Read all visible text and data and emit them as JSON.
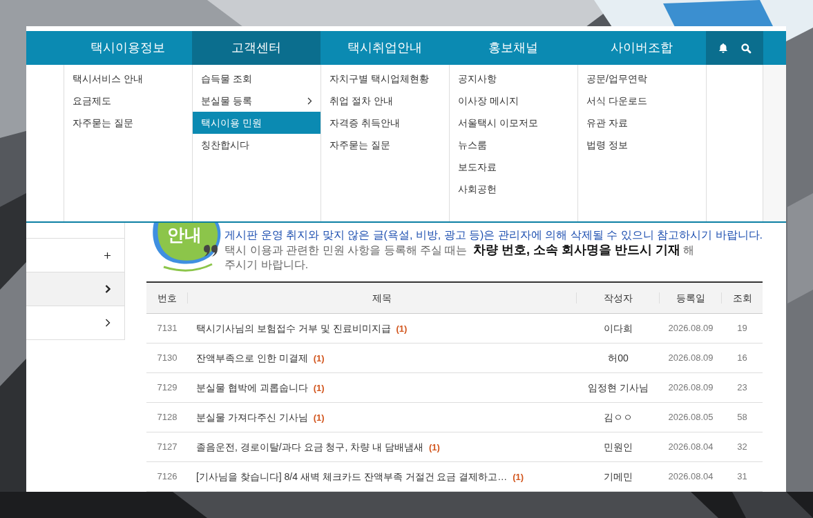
{
  "nav": {
    "items": [
      {
        "label": "택시이용정보",
        "selected": false
      },
      {
        "label": "고객센터",
        "selected": true
      },
      {
        "label": "택시취업안내",
        "selected": false
      },
      {
        "label": "홍보채널",
        "selected": false
      },
      {
        "label": "사이버조합",
        "selected": false
      }
    ]
  },
  "menu_columns": [
    {
      "items": [
        {
          "label": "택시서비스 안내",
          "selected": false,
          "has_submenu": false
        },
        {
          "label": "요금제도",
          "selected": false,
          "has_submenu": false
        },
        {
          "label": "자주묻는 질문",
          "selected": false,
          "has_submenu": false
        }
      ]
    },
    {
      "items": [
        {
          "label": "습득물 조회",
          "selected": false,
          "has_submenu": false
        },
        {
          "label": "분실물 등록",
          "selected": false,
          "has_submenu": true
        },
        {
          "label": "택시이용 민원",
          "selected": true,
          "has_submenu": false
        },
        {
          "label": "칭찬합시다",
          "selected": false,
          "has_submenu": false
        }
      ]
    },
    {
      "items": [
        {
          "label": "자치구별 택시업체현황",
          "selected": false,
          "has_submenu": false
        },
        {
          "label": "취업 절차 안내",
          "selected": false,
          "has_submenu": false
        },
        {
          "label": "자격증 취득안내",
          "selected": false,
          "has_submenu": false
        },
        {
          "label": "자주묻는 질문",
          "selected": false,
          "has_submenu": false
        }
      ]
    },
    {
      "items": [
        {
          "label": "공지사항",
          "selected": false,
          "has_submenu": false
        },
        {
          "label": "이사장 메시지",
          "selected": false,
          "has_submenu": false
        },
        {
          "label": "서울택시 이모저모",
          "selected": false,
          "has_submenu": false
        },
        {
          "label": "뉴스룸",
          "selected": false,
          "has_submenu": false
        },
        {
          "label": "보도자료",
          "selected": false,
          "has_submenu": false
        },
        {
          "label": "사회공헌",
          "selected": false,
          "has_submenu": false
        }
      ]
    },
    {
      "items": [
        {
          "label": "공문/업무연락",
          "selected": false,
          "has_submenu": false
        },
        {
          "label": "서식 다운로드",
          "selected": false,
          "has_submenu": false
        },
        {
          "label": "유관 자료",
          "selected": false,
          "has_submenu": false
        },
        {
          "label": "법령 정보",
          "selected": false,
          "has_submenu": false
        }
      ]
    }
  ],
  "sidebar": {
    "items": [
      {
        "kind": "plus",
        "selected": false
      },
      {
        "kind": "chevron",
        "selected": true
      },
      {
        "kind": "chevron",
        "selected": false
      }
    ]
  },
  "notice": {
    "badge": "안내",
    "warning": "게시판 운영 취지와 맞지 않은 글(욕설, 비방, 광고 등)은 관리자에 의해 삭제될 수 있으니 참고하시기 바랍니다.",
    "text": "택시 이용과 관련한 민원 사항을 등록해 주실 때는 **차량 번호, 소속 회사명을 반드시 기재** 해 주시기 바랍니다."
  },
  "table": {
    "columns": [
      "번호",
      "제목",
      "작성자",
      "등록일",
      "조회"
    ],
    "rows": [
      {
        "number": "7131",
        "title": "택시기사님의 보험접수 거부 및 진료비미지급 **(1)**",
        "author": "이다희",
        "date": "2026.08.09",
        "views": "19"
      },
      {
        "number": "7130",
        "title": "잔액부족으로 인한 미결제 **(1)**",
        "author": "허00",
        "date": "2026.08.09",
        "views": "16"
      },
      {
        "number": "7129",
        "title": "분실물 협박에 괴롭숩니다 **(1)**",
        "author": "임정현 기사님",
        "date": "2026.08.09",
        "views": "23"
      },
      {
        "number": "7128",
        "title": "분실물 가져다주신 기사님 **(1)**",
        "author": "김ㅇㅇ",
        "date": "2026.08.05",
        "views": "58"
      },
      {
        "number": "7127",
        "title": "졸음운전, 경로이탈/과다 요금 청구, 차량 내 담배냄새 **(1)**",
        "author": "민원인",
        "date": "2026.08.04",
        "views": "32"
      },
      {
        "number": "7126",
        "title": "[기사님을 찾습니다] 8/4 새벽 체크카드 잔액부족 거절건 요금 결제하고… **(1)**",
        "author": "기메민",
        "date": "2026.08.04",
        "views": "31"
      }
    ]
  }
}
